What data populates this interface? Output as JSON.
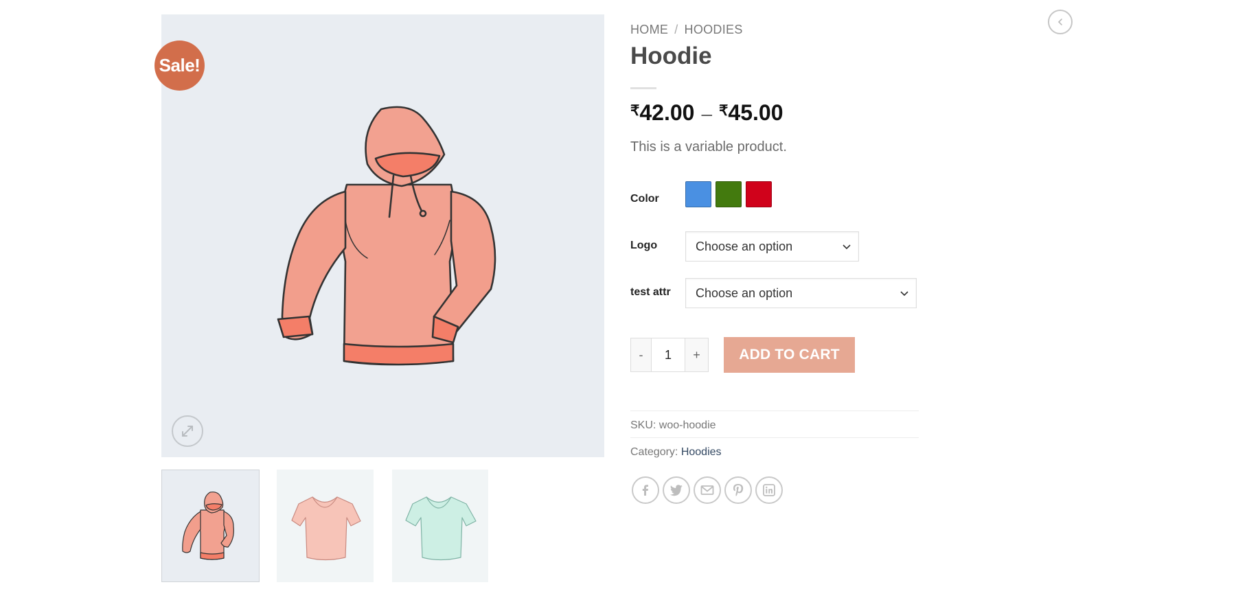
{
  "gallery": {
    "sale_badge": "Sale!",
    "images": [
      {
        "name": "hoodie",
        "color": "#f2a08d"
      },
      {
        "name": "pink-v-neck-tee",
        "color": "#f7c2b5"
      },
      {
        "name": "mint-v-neck-tee",
        "color": "#cdeee3"
      }
    ]
  },
  "breadcrumb": {
    "home": "HOME",
    "separator": "/",
    "category": "HOODIES"
  },
  "product": {
    "title": "Hoodie",
    "currency": "₹",
    "price_min": "42.00",
    "price_dash": "–",
    "price_max": "45.00",
    "short_description": "This is a variable product."
  },
  "variations": {
    "color_label": "Color",
    "colors": [
      "#4a90e2",
      "#437a0e",
      "#d0021b"
    ],
    "logo_label": "Logo",
    "logo_value": "Choose an option",
    "test_label": "test attr",
    "test_value": "Choose an option"
  },
  "cart": {
    "minus": "-",
    "quantity": "1",
    "plus": "+",
    "add_to_cart": "ADD TO CART"
  },
  "meta": {
    "sku_label": "SKU:",
    "sku": "woo-hoodie",
    "category_label": "Category:",
    "category": "Hoodies"
  },
  "share_icons": [
    "facebook-icon",
    "twitter-icon",
    "email-icon",
    "pinterest-icon",
    "linkedin-icon"
  ],
  "colors": {
    "sale": "#d26e4b",
    "button": "#e6a893",
    "link": "#334862",
    "image_bg": "#e9edf2"
  }
}
